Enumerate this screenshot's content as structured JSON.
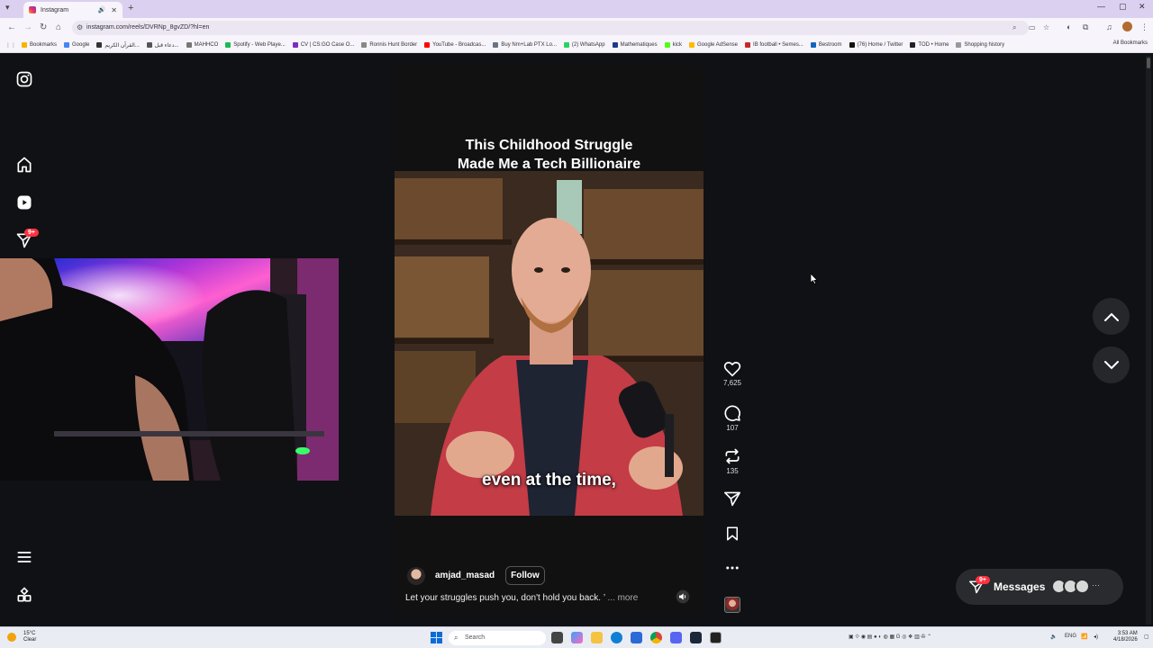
{
  "browser": {
    "tab_title": "Instagram",
    "url": "instagram.com/reels/DVRNp_8gvZD/?hl=en",
    "bookmarks": [
      {
        "label": "Bookmarks",
        "color": "#f4b400"
      },
      {
        "label": "Google",
        "color": "#4285f4"
      },
      {
        "label": "القرآن الكريم...",
        "color": "#333333"
      },
      {
        "label": "دعاء قبل...",
        "color": "#555555"
      },
      {
        "label": "MAHHCO",
        "color": "#777777"
      },
      {
        "label": "Spotify - Web Playe...",
        "color": "#1db954"
      },
      {
        "label": "CV | CS:GO Case O...",
        "color": "#7b2cbf"
      },
      {
        "label": "Ronnis Hunt Border",
        "color": "#888888"
      },
      {
        "label": "YouTube - Broadcas...",
        "color": "#ff0000"
      },
      {
        "label": "Buy Nm+Lab PTX Lo...",
        "color": "#6b7280"
      },
      {
        "label": "(2) WhatsApp",
        "color": "#25d366"
      },
      {
        "label": "Mathematiques",
        "color": "#1e3a8a"
      },
      {
        "label": "kick",
        "color": "#53fc18"
      },
      {
        "label": "Google AdSense",
        "color": "#fbbc05"
      },
      {
        "label": "IB football • Semes...",
        "color": "#c62828"
      },
      {
        "label": "Bestroom",
        "color": "#1565c0"
      },
      {
        "label": "(76) Home / Twitter",
        "color": "#111111"
      },
      {
        "label": "TOD • Home",
        "color": "#222222"
      },
      {
        "label": "Shopping history",
        "color": "#999999"
      }
    ],
    "all_bookmarks_label": "All Bookmarks"
  },
  "instagram": {
    "notification_badge": "9+",
    "reel": {
      "headline_line1": "This Childhood Struggle",
      "headline_line2": "Made Me a Tech Billionaire",
      "subtitle": "even at the time,",
      "username": "amjad_masad",
      "follow_label": "Follow",
      "caption": "Let your struggles push you, don't hold you back. ’",
      "more_label": "... more"
    },
    "actions": {
      "likes": "7,625",
      "comments": "107",
      "reposts": "135"
    },
    "messages": {
      "label": "Messages",
      "badge": "9+"
    }
  },
  "taskbar": {
    "weather_temp": "15°C",
    "weather_desc": "Clear",
    "search_placeholder": "Search",
    "lang": "ENG",
    "time": "3:53 AM",
    "date": "4/18/2026"
  },
  "colors": {
    "ig_background": "#101114",
    "badge_red": "#ff3040",
    "chrome_tabstrip": "#dcd0f0"
  }
}
